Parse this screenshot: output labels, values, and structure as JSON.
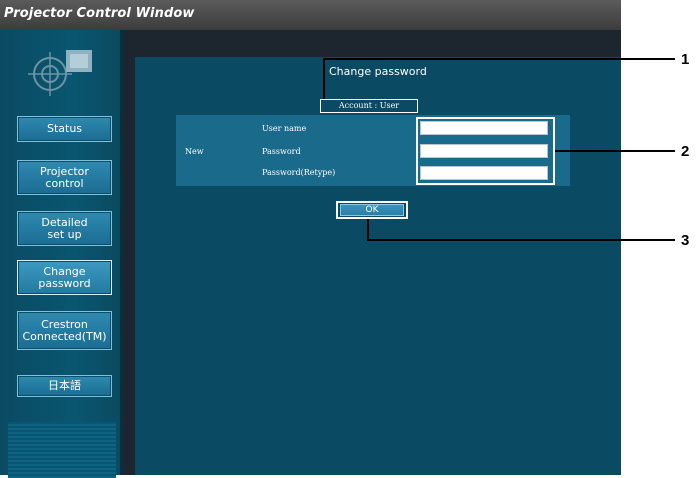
{
  "window": {
    "title": "Projector Control Window"
  },
  "sidebar": {
    "items": [
      {
        "label": "Status"
      },
      {
        "label": "Projector\ncontrol"
      },
      {
        "label": "Detailed\nset up"
      },
      {
        "label": "Change\npassword"
      },
      {
        "label": "Crestron\nConnected(TM)"
      },
      {
        "label": "日本語"
      }
    ],
    "active_index": 3
  },
  "main": {
    "title": "Change password",
    "account": "Account : User",
    "form": {
      "section_label": "New",
      "fields": [
        {
          "label": "User name",
          "value": ""
        },
        {
          "label": "Password",
          "value": ""
        },
        {
          "label": "Password(Retype)",
          "value": ""
        }
      ]
    },
    "ok_label": "OK"
  },
  "callouts": [
    "1",
    "2",
    "3"
  ],
  "colors": {
    "accent": "#0a4a62",
    "panel": "#1a6a8c",
    "button": "#2a7fa6"
  }
}
